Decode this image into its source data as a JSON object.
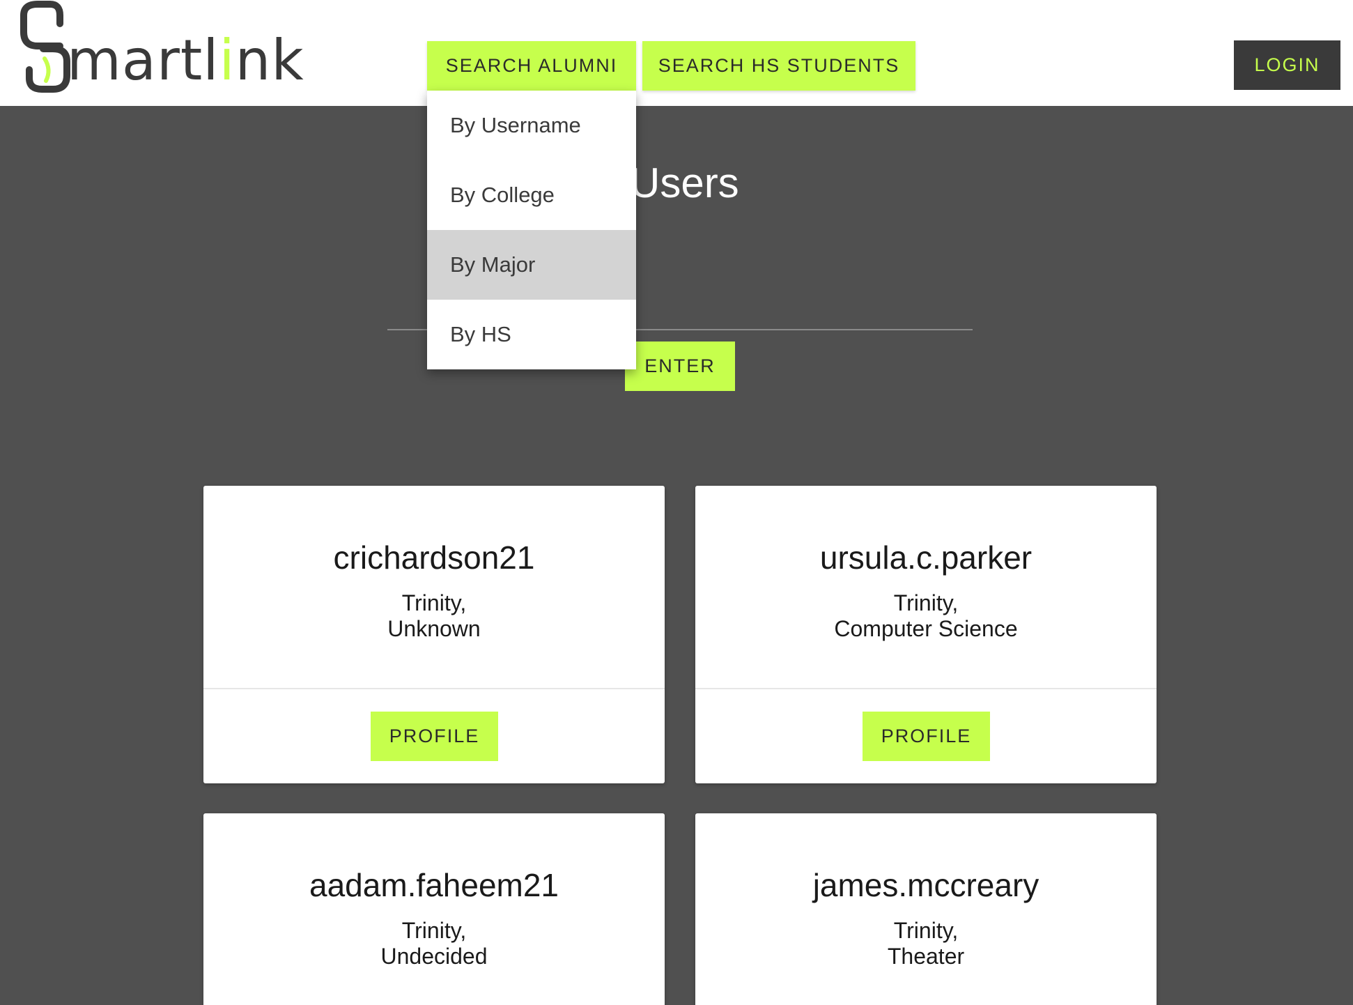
{
  "header": {
    "logo": {
      "text_prefix": "martl",
      "text_accent": "i",
      "text_suffix": "nk",
      "full_name": "Smartlink"
    },
    "nav": {
      "search_alumni": "SEARCH ALUMNI",
      "search_hs_students": "SEARCH HS STUDENTS"
    },
    "login_label": "LOGIN"
  },
  "dropdown": {
    "items": [
      {
        "label": "By Username"
      },
      {
        "label": "By College"
      },
      {
        "label": "By Major"
      },
      {
        "label": "By HS"
      }
    ],
    "highlighted": "By Major"
  },
  "main": {
    "title_visible": "Users",
    "search_input_value": "",
    "enter_label": "ENTER"
  },
  "cards": [
    {
      "username": "crichardson21",
      "college": "Trinity,",
      "major": "Unknown",
      "button": "PROFILE"
    },
    {
      "username": "ursula.c.parker",
      "college": "Trinity,",
      "major": "Computer Science",
      "button": "PROFILE"
    },
    {
      "username": "aadam.faheem21",
      "college": "Trinity,",
      "major": "Undecided"
    },
    {
      "username": "james.mccreary",
      "college": "Trinity,",
      "major": "Theater"
    }
  ],
  "colors": {
    "accent": "#c6ff4c",
    "background": "#505050",
    "dark": "#3a3a3a",
    "highlight": "#d3d3d3"
  },
  "icons": {
    "logo_mark": "chain-link-s-icon"
  }
}
